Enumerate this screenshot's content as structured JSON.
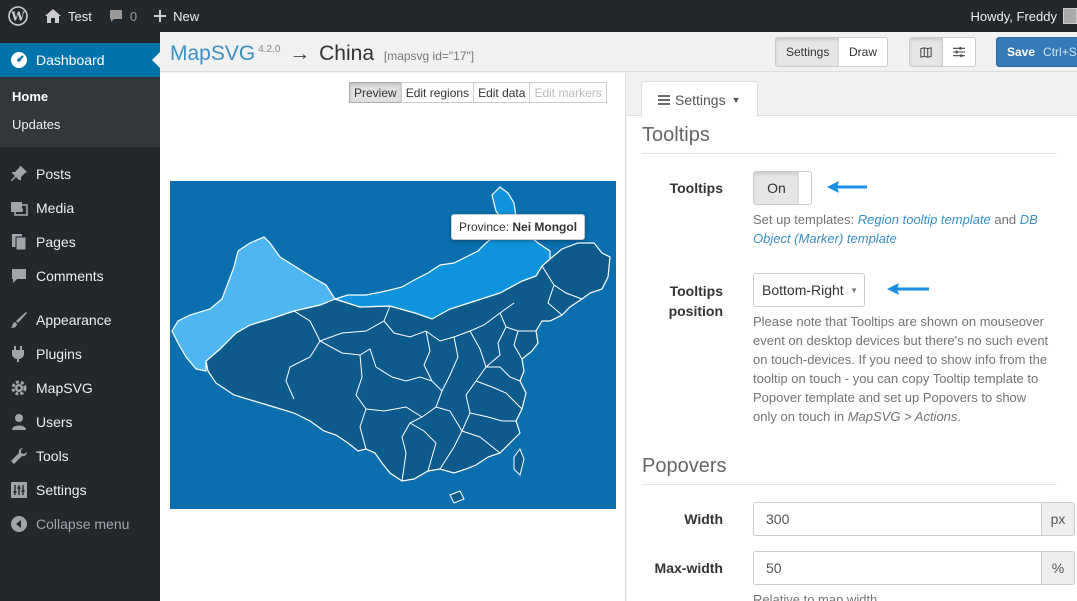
{
  "adminbar": {
    "site_name": "Test",
    "comments_count": "0",
    "new_label": "New",
    "greeting": "Howdy, Freddy"
  },
  "sidebar": {
    "dashboard": "Dashboard",
    "submenu": [
      "Home",
      "Updates"
    ],
    "items": [
      {
        "label": "Posts",
        "icon": "pin-icon"
      },
      {
        "label": "Media",
        "icon": "media-icon"
      },
      {
        "label": "Pages",
        "icon": "pages-icon"
      },
      {
        "label": "Comments",
        "icon": "comment-icon"
      },
      {
        "label": "Appearance",
        "icon": "brush-icon"
      },
      {
        "label": "Plugins",
        "icon": "plugin-icon"
      },
      {
        "label": "MapSVG",
        "icon": "gear-icon"
      },
      {
        "label": "Users",
        "icon": "user-icon"
      },
      {
        "label": "Tools",
        "icon": "wrench-icon"
      },
      {
        "label": "Settings",
        "icon": "settings-icon"
      }
    ],
    "collapse": "Collapse menu"
  },
  "header": {
    "app": "MapSVG",
    "version": "4.2.0",
    "arrow": "→",
    "map_name": "China",
    "shortcode": "[mapsvg id=\"17\"]",
    "settings_btn": "Settings",
    "draw_btn": "Draw",
    "save_btn": "Save",
    "save_shortcut": "Ctrl+S"
  },
  "modes": [
    "Preview",
    "Edit regions",
    "Edit data",
    "Edit markers"
  ],
  "tooltip": {
    "prefix": "Province:",
    "name": "Nei Mongol"
  },
  "settings": {
    "tab_label": "Settings",
    "tooltips_section": "Tooltips",
    "tooltips_label": "Tooltips",
    "tooltips_value": "On",
    "templates_prefix": "Set up templates:",
    "region_template_link": "Region tooltip template",
    "and_word": "and",
    "db_template_link": "DB Object (Marker) template",
    "position_label": "Tooltips position",
    "position_value": "Bottom-Right",
    "position_help": "Please note that Tooltips are shown on mouseover event on desktop devices but there's no such event on touch-devices. If you need to show info from the tooltip on touch - you can copy Tooltip template to Popover template and set up Popovers to show only on touch in",
    "position_help_link": "MapSVG > Actions",
    "popovers_section": "Popovers",
    "width_label": "Width",
    "width_value": "300",
    "width_unit": "px",
    "maxwidth_label": "Max-width",
    "maxwidth_value": "50",
    "maxwidth_unit": "%",
    "maxwidth_help": "Relative to map width"
  },
  "colors": {
    "wp_dark": "#23282d",
    "wp_blue": "#0073aa",
    "map_water": "#0a6fae",
    "region_dark": "#0d5a8c",
    "region_highlight": "#0e94dd",
    "region_light": "#4eb6f0",
    "annotation_arrow": "#1a8fe3"
  }
}
